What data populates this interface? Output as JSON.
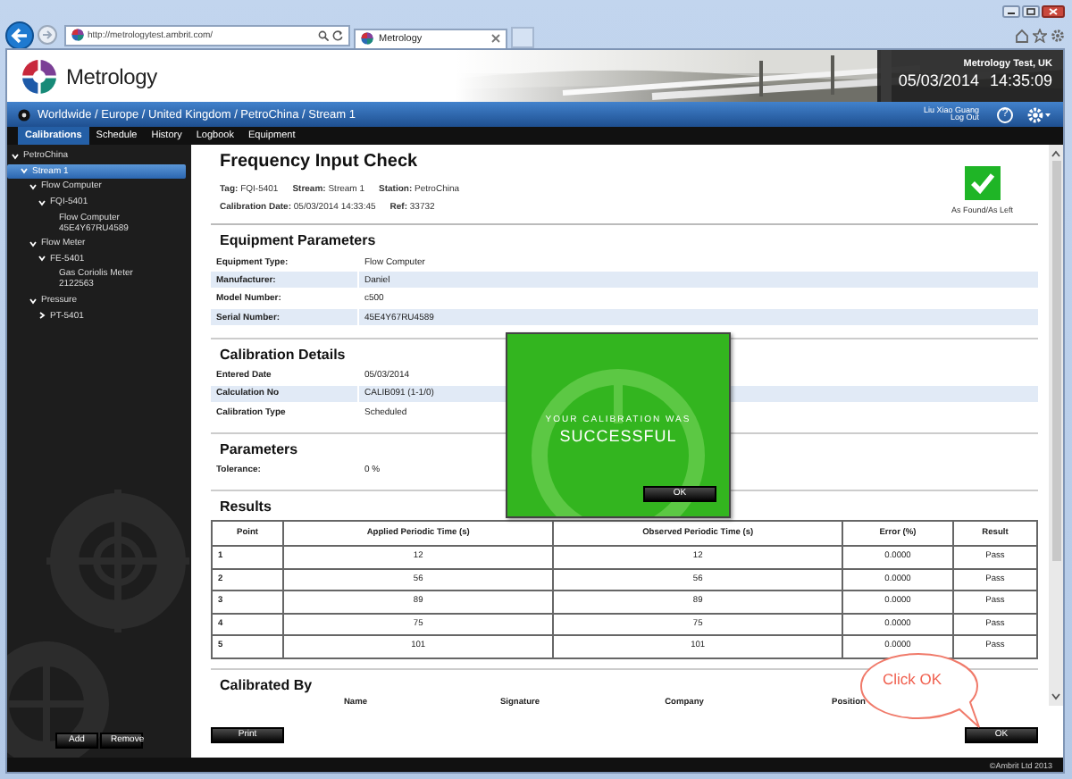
{
  "browser": {
    "address": "http://metrologytest.ambrit.com/",
    "tab": "Metrology"
  },
  "header": {
    "logo": "Metrology",
    "site": "Metrology Test, UK",
    "date": "05/03/2014",
    "time": "14:35:09"
  },
  "breadcrumb": "Worldwide / Europe / United Kingdom / PetroChina / Stream 1",
  "user": {
    "name": "Liu Xiao Guang",
    "logout": "Log Out",
    "help": "?"
  },
  "nav_tabs": [
    {
      "label": "Calibrations",
      "selected": true
    },
    {
      "label": "Schedule",
      "selected": false
    },
    {
      "label": "History",
      "selected": false
    },
    {
      "label": "Logbook",
      "selected": false
    },
    {
      "label": "Equipment",
      "selected": false
    }
  ],
  "tree": [
    {
      "label": "PetroChina",
      "expanded": true,
      "selected": false,
      "children": [
        {
          "label": "Stream 1",
          "expanded": true,
          "selected": true,
          "children": [
            {
              "label": "Flow Computer",
              "expanded": true,
              "selected": false,
              "children": [
                {
                  "label": "FQI-5401",
                  "expanded": true,
                  "selected": false,
                  "children": [
                    {
                      "label": "Flow Computer\n45E4Y67RU4589",
                      "selected": false
                    }
                  ]
                }
              ]
            },
            {
              "label": "Flow Meter",
              "expanded": true,
              "selected": false,
              "children": [
                {
                  "label": "FE-5401",
                  "expanded": true,
                  "selected": false,
                  "children": [
                    {
                      "label": "Gas Coriolis Meter\n2122563",
                      "selected": false
                    }
                  ]
                }
              ]
            },
            {
              "label": "Pressure",
              "expanded": true,
              "selected": false,
              "children": [
                {
                  "label": "PT-5401",
                  "expanded": false,
                  "selected": false
                }
              ]
            }
          ]
        }
      ]
    }
  ],
  "sidebar_buttons": [
    "Add",
    "Remove"
  ],
  "check": {
    "title": "Frequency Input Check",
    "meta_lines": [
      [
        "**Tag:** FQI-5401",
        "**Stream:** Stream 1",
        "**Station:** PetroChina"
      ],
      [
        "**Calibration Date:** 05/03/2014 14:33:45",
        "**Ref:** 33732"
      ]
    ],
    "status_label": "As Found/As Left"
  },
  "sections": [
    {
      "title": "Equipment Parameters",
      "fields": [
        {
          "label": "Equipment Type:",
          "value": "Flow Computer"
        },
        {
          "label": "Manufacturer:",
          "value": "Daniel"
        },
        {
          "label": "Model Number:",
          "value": "c500"
        },
        {
          "label": "Serial Number:",
          "value": "45E4Y67RU4589"
        }
      ]
    },
    {
      "title": "Calibration Details",
      "fields": [
        {
          "label": "Entered Date",
          "value": "05/03/2014"
        },
        {
          "label": "Calculation No",
          "value": "CALIB091 (1-1/0)"
        },
        {
          "label": "Calibration Type",
          "value": "Scheduled"
        }
      ]
    },
    {
      "title": "Parameters",
      "fields": [
        {
          "label": "Tolerance:",
          "value": "0 %"
        }
      ]
    }
  ],
  "results": {
    "title": "Results",
    "columns": [
      "Point",
      "Applied Periodic Time (s)",
      "Observed Periodic Time (s)",
      "Error (%)",
      "Result"
    ],
    "rows": [
      [
        "1",
        "12",
        "12",
        "0.0000",
        "Pass"
      ],
      [
        "2",
        "56",
        "56",
        "0.0000",
        "Pass"
      ],
      [
        "3",
        "89",
        "89",
        "0.0000",
        "Pass"
      ],
      [
        "4",
        "75",
        "75",
        "0.0000",
        "Pass"
      ],
      [
        "5",
        "101",
        "101",
        "0.0000",
        "Pass"
      ]
    ]
  },
  "calibrated_by": {
    "title": "Calibrated By",
    "columns": [
      "Name",
      "Signature",
      "Company",
      "Position"
    ]
  },
  "buttons": [
    "Print",
    "OK"
  ],
  "dialog": {
    "lines": [
      "YOUR CALIBRATION WAS",
      "SUCCESSFUL"
    ],
    "button": "OK"
  },
  "callout": "Click OK",
  "footer": "©Ambrit Ltd 2013"
}
